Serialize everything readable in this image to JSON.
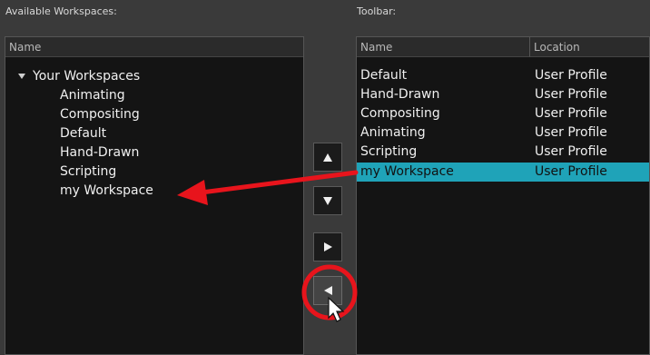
{
  "available": {
    "label": "Available Workspaces:",
    "column": "Name",
    "root": "Your Workspaces",
    "items": [
      "Animating",
      "Compositing",
      "Default",
      "Hand-Drawn",
      "Scripting",
      "my Workspace"
    ]
  },
  "toolbar": {
    "label": "Toolbar:",
    "columns": {
      "name": "Name",
      "location": "Location"
    },
    "rows": [
      {
        "name": "Default",
        "location": "User Profile"
      },
      {
        "name": "Hand-Drawn",
        "location": "User Profile"
      },
      {
        "name": "Compositing",
        "location": "User Profile"
      },
      {
        "name": "Animating",
        "location": "User Profile"
      },
      {
        "name": "Scripting",
        "location": "User Profile"
      },
      {
        "name": "my Workspace",
        "location": "User Profile",
        "selected": true
      }
    ]
  },
  "buttons": [
    "move-up",
    "move-down",
    "add-to-toolbar",
    "remove-from-toolbar"
  ],
  "colors": {
    "selection": "#1fa3b8",
    "annotation": "#e8141c"
  }
}
